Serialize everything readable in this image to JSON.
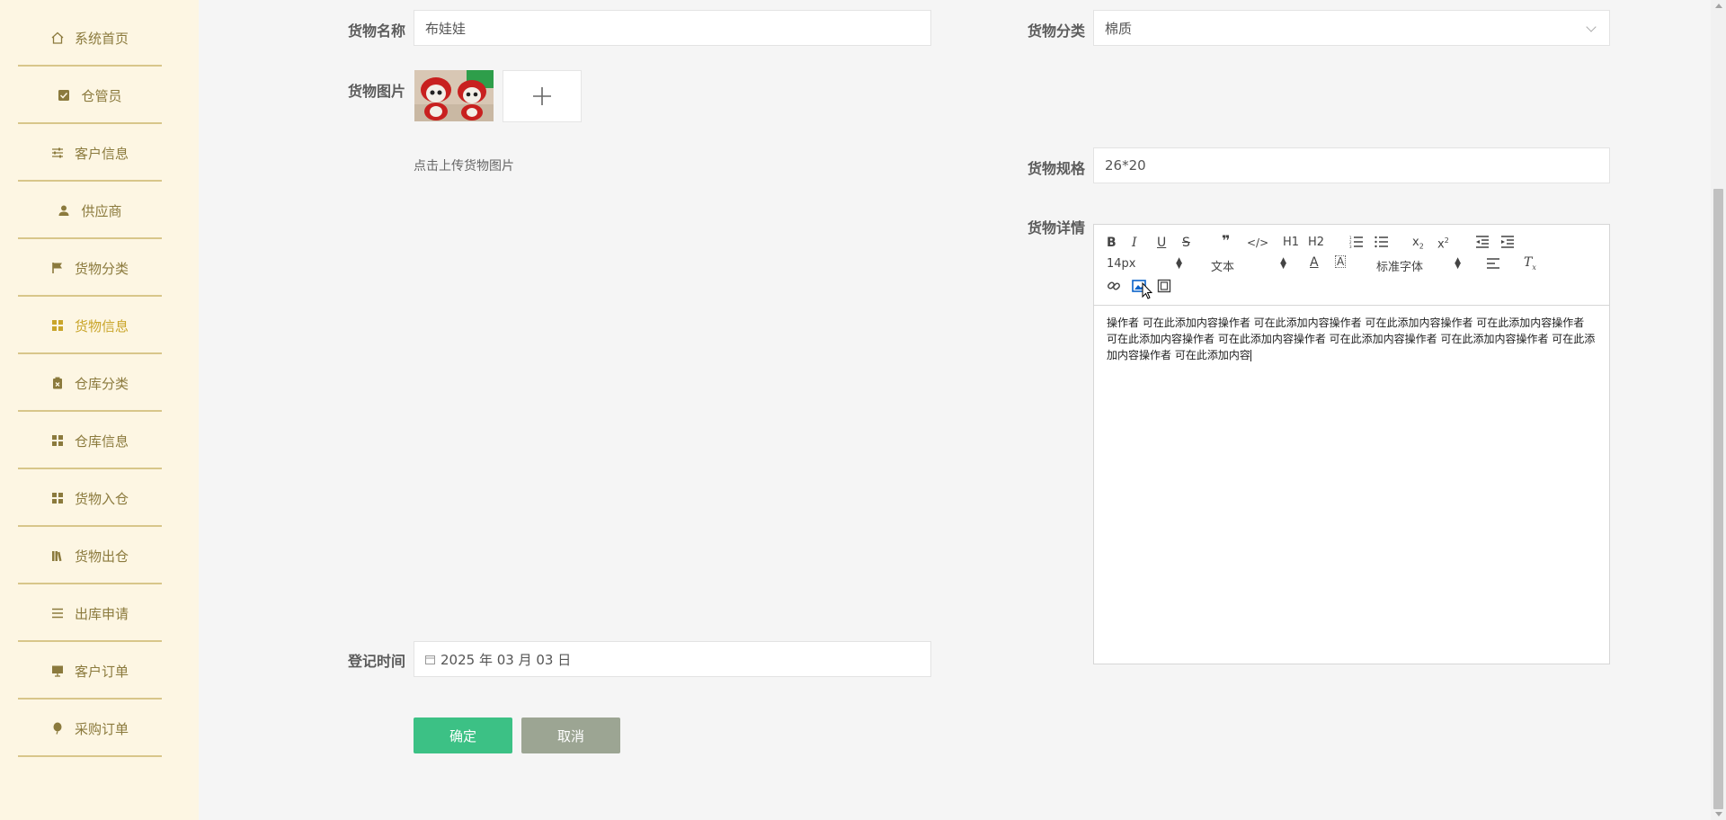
{
  "sidebar": {
    "items": [
      {
        "label": "系统首页",
        "icon": "home-icon"
      },
      {
        "label": "仓管员",
        "icon": "check-square-icon"
      },
      {
        "label": "客户信息",
        "icon": "sliders-icon"
      },
      {
        "label": "供应商",
        "icon": "user-icon"
      },
      {
        "label": "货物分类",
        "icon": "flag-icon"
      },
      {
        "label": "货物信息",
        "icon": "grid-icon"
      },
      {
        "label": "仓库分类",
        "icon": "clipboard-icon"
      },
      {
        "label": "仓库信息",
        "icon": "grid-icon"
      },
      {
        "label": "货物入仓",
        "icon": "grid-icon"
      },
      {
        "label": "货物出仓",
        "icon": "library-icon"
      },
      {
        "label": "出库申请",
        "icon": "list-icon"
      },
      {
        "label": "客户订单",
        "icon": "monitor-icon"
      },
      {
        "label": "采购订单",
        "icon": "balloon-icon"
      }
    ],
    "active_index": 5,
    "colors": {
      "bg": "#fdf6e3",
      "text": "#8b7a3d",
      "active": "#c9a52a",
      "divider": "#d8c68a"
    }
  },
  "form": {
    "name_label": "货物名称",
    "name_value": "布娃娃",
    "category_label": "货物分类",
    "category_value": "棉质",
    "image_label": "货物图片",
    "upload_hint": "点击上传货物图片",
    "spec_label": "货物规格",
    "spec_value": "26*20",
    "detail_label": "货物详情",
    "date_label": "登记时间",
    "date_value": "2025 年 03 月 03 日",
    "submit": "确定",
    "cancel": "取消"
  },
  "editor": {
    "font_size": "14px",
    "header_select": "文本",
    "font_family": "标准字体",
    "content": "操作者 可在此添加内容操作者 可在此添加内容操作者 可在此添加内容操作者 可在此添加内容操作者 可在此添加内容操作者 可在此添加内容操作者 可在此添加内容操作者 可在此添加内容操作者 可在此添加内容操作者 可在此添加内容",
    "toolbar_labels": {
      "h1": "H1",
      "h2": "H2",
      "bold": "B",
      "italic": "I",
      "underline": "U",
      "strike": "S"
    }
  },
  "colors": {
    "primary": "#3cc185",
    "cancel": "#9ca593",
    "page_bg": "#f5f5f5"
  }
}
